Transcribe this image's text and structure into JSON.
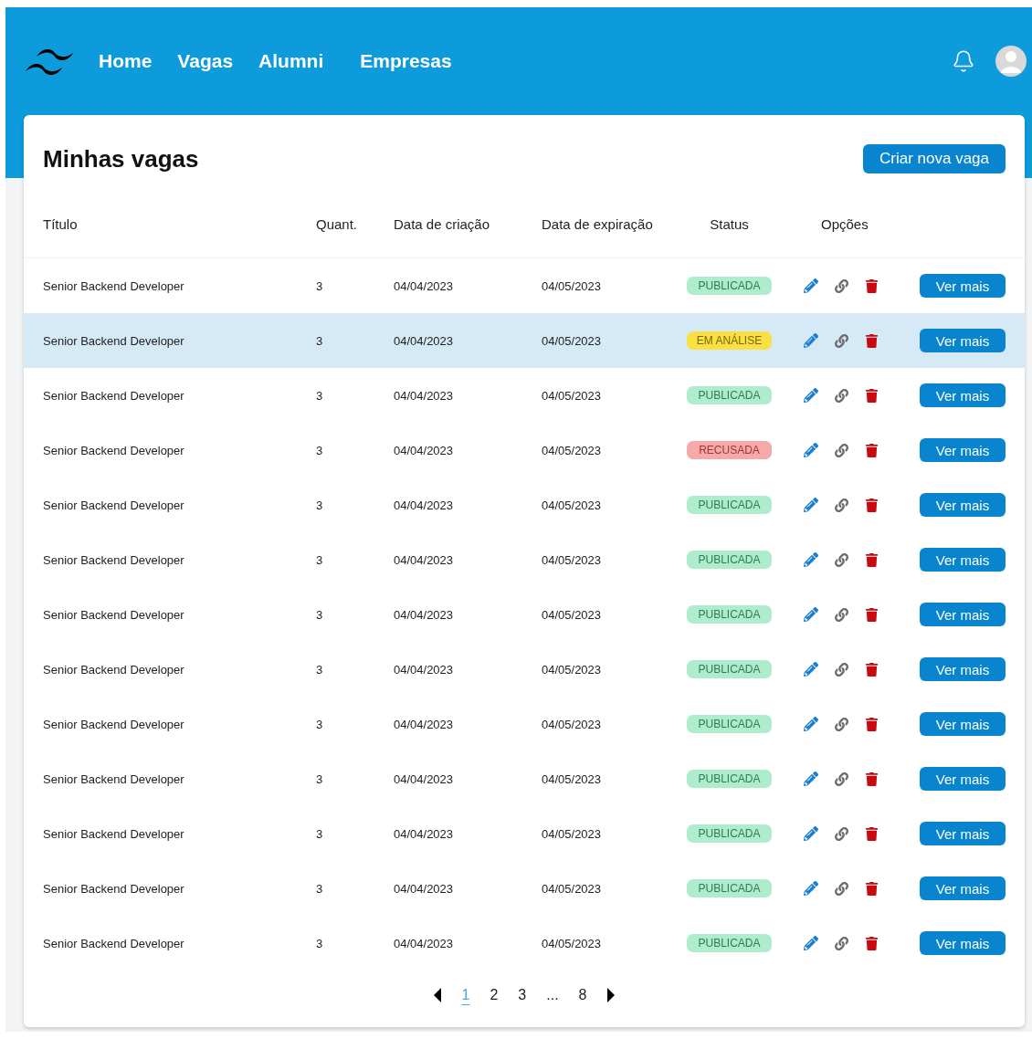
{
  "nav": {
    "links": [
      {
        "label": "Home"
      },
      {
        "label": "Vagas"
      },
      {
        "label": "Alumni"
      },
      {
        "label": "Empresas"
      }
    ]
  },
  "card": {
    "title": "Minhas vagas",
    "create_button": "Criar nova vaga"
  },
  "table": {
    "columns": [
      "Título",
      "Quant.",
      "Data de criação",
      "Data de expiração",
      "Status",
      "Opções"
    ],
    "rows": [
      {
        "title": "Senior Backend Developer",
        "quantity": "3",
        "created": "04/04/2023",
        "expires": "04/05/2023",
        "status": "PUBLICADA",
        "kind": "published",
        "selected": false,
        "action": "Ver mais"
      },
      {
        "title": "Senior Backend Developer",
        "quantity": "3",
        "created": "04/04/2023",
        "expires": "04/05/2023",
        "status": "EM ANÁLISE",
        "kind": "review",
        "selected": true,
        "action": "Ver mais"
      },
      {
        "title": "Senior Backend Developer",
        "quantity": "3",
        "created": "04/04/2023",
        "expires": "04/05/2023",
        "status": "PUBLICADA",
        "kind": "published",
        "selected": false,
        "action": "Ver mais"
      },
      {
        "title": "Senior Backend Developer",
        "quantity": "3",
        "created": "04/04/2023",
        "expires": "04/05/2023",
        "status": "RECUSADA",
        "kind": "refused",
        "selected": false,
        "action": "Ver mais"
      },
      {
        "title": "Senior Backend Developer",
        "quantity": "3",
        "created": "04/04/2023",
        "expires": "04/05/2023",
        "status": "PUBLICADA",
        "kind": "published",
        "selected": false,
        "action": "Ver mais"
      },
      {
        "title": "Senior Backend Developer",
        "quantity": "3",
        "created": "04/04/2023",
        "expires": "04/05/2023",
        "status": "PUBLICADA",
        "kind": "published",
        "selected": false,
        "action": "Ver mais"
      },
      {
        "title": "Senior Backend Developer",
        "quantity": "3",
        "created": "04/04/2023",
        "expires": "04/05/2023",
        "status": "PUBLICADA",
        "kind": "published",
        "selected": false,
        "action": "Ver mais"
      },
      {
        "title": "Senior Backend Developer",
        "quantity": "3",
        "created": "04/04/2023",
        "expires": "04/05/2023",
        "status": "PUBLICADA",
        "kind": "published",
        "selected": false,
        "action": "Ver mais"
      },
      {
        "title": "Senior Backend Developer",
        "quantity": "3",
        "created": "04/04/2023",
        "expires": "04/05/2023",
        "status": "PUBLICADA",
        "kind": "published",
        "selected": false,
        "action": "Ver mais"
      },
      {
        "title": "Senior Backend Developer",
        "quantity": "3",
        "created": "04/04/2023",
        "expires": "04/05/2023",
        "status": "PUBLICADA",
        "kind": "published",
        "selected": false,
        "action": "Ver mais"
      },
      {
        "title": "Senior Backend Developer",
        "quantity": "3",
        "created": "04/04/2023",
        "expires": "04/05/2023",
        "status": "PUBLICADA",
        "kind": "published",
        "selected": false,
        "action": "Ver mais"
      },
      {
        "title": "Senior Backend Developer",
        "quantity": "3",
        "created": "04/04/2023",
        "expires": "04/05/2023",
        "status": "PUBLICADA",
        "kind": "published",
        "selected": false,
        "action": "Ver mais"
      },
      {
        "title": "Senior Backend Developer",
        "quantity": "3",
        "created": "04/04/2023",
        "expires": "04/05/2023",
        "status": "PUBLICADA",
        "kind": "published",
        "selected": false,
        "action": "Ver mais"
      }
    ]
  },
  "pagination": {
    "pages": [
      {
        "label": "1",
        "selected": true
      },
      {
        "label": "2",
        "selected": false
      },
      {
        "label": "3",
        "selected": false
      },
      {
        "label": "...",
        "selected": false
      },
      {
        "label": "8",
        "selected": false
      }
    ]
  }
}
